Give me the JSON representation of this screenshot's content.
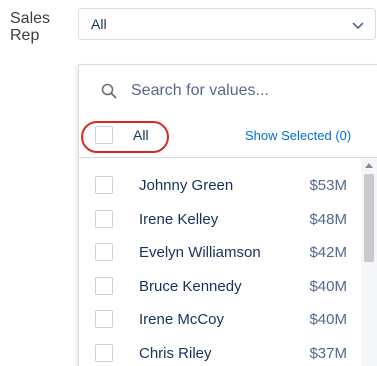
{
  "field": {
    "label": "Sales Rep",
    "selected_value": "All"
  },
  "search": {
    "placeholder": "Search for values..."
  },
  "all_option": {
    "label": "All"
  },
  "show_selected": {
    "label": "Show Selected (0)"
  },
  "reps": [
    {
      "name": "Johnny Green",
      "value": "$53M"
    },
    {
      "name": "Irene Kelley",
      "value": "$48M"
    },
    {
      "name": "Evelyn Williamson",
      "value": "$42M"
    },
    {
      "name": "Bruce Kennedy",
      "value": "$40M"
    },
    {
      "name": "Irene McCoy",
      "value": "$40M"
    },
    {
      "name": "Chris Riley",
      "value": "$37M"
    }
  ],
  "icons": {
    "dropdown": "chevron-down-icon",
    "search": "search-icon",
    "scroll_up": "scroll-up-arrow-icon"
  },
  "colors": {
    "highlight_circle": "#d9291c",
    "link": "#0070d2"
  }
}
